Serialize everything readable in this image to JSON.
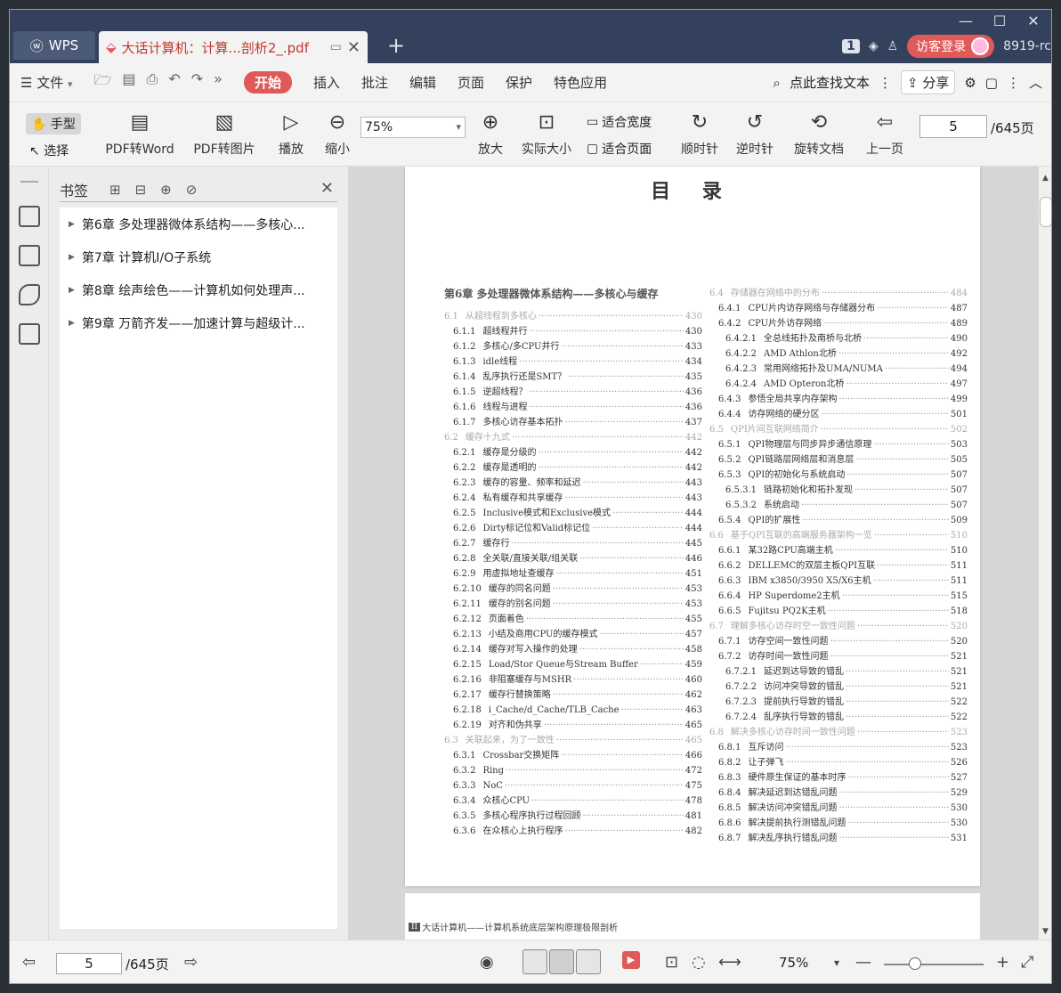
{
  "tabs": {
    "wps_label": "WPS",
    "doc_title": "大话计算机：计算...剖析2_.pdf",
    "add": "+"
  },
  "titlebar": {
    "badge": "1",
    "login": "访客登录",
    "user": "8919-rc"
  },
  "menu": {
    "file": "文件",
    "items": [
      "开始",
      "插入",
      "批注",
      "编辑",
      "页面",
      "保护",
      "特色应用"
    ],
    "search": "点此查找文本",
    "share": "分享"
  },
  "ribbon": {
    "hand": "手型",
    "select": "选择",
    "pdf_to_word": "PDF转Word",
    "pdf_to_image": "PDF转图片",
    "play": "播放",
    "zoom_out": "缩小",
    "zoom_value": "75%",
    "zoom_in": "放大",
    "actual_size": "实际大小",
    "fit_width": "适合宽度",
    "fit_page": "适合页面",
    "clockwise": "顺时针",
    "counter_clockwise": "逆时针",
    "rotate_doc": "旋转文档",
    "prev_page": "上一页",
    "page_value": "5",
    "page_total": "/645页"
  },
  "bookmarks": {
    "label": "书签",
    "items": [
      "第6章  多处理器微体系结构——多核心...",
      "第7章  计算机I/O子系统",
      "第8章  绘声绘色——计算机如何处理声...",
      "第9章  万箭齐发——加速计算与超级计..."
    ]
  },
  "toc": {
    "title": "目 录",
    "left_chapter": "第6章   多处理器微体系结构——多核心与缓存",
    "left": [
      {
        "n": "6.1",
        "t": "从超线程到多核心",
        "p": "430",
        "k": "sec"
      },
      {
        "n": "6.1.1",
        "t": "超线程并行",
        "p": "430",
        "k": "lvl1"
      },
      {
        "n": "6.1.2",
        "t": "多核心/多CPU并行",
        "p": "433",
        "k": "lvl1"
      },
      {
        "n": "6.1.3",
        "t": "idle线程",
        "p": "434",
        "k": "lvl1"
      },
      {
        "n": "6.1.4",
        "t": "乱序执行还是SMT？",
        "p": "435",
        "k": "lvl1"
      },
      {
        "n": "6.1.5",
        "t": "逆超线程？",
        "p": "436",
        "k": "lvl1"
      },
      {
        "n": "6.1.6",
        "t": "线程与进程",
        "p": "436",
        "k": "lvl1"
      },
      {
        "n": "6.1.7",
        "t": "多核心访存基本拓扑",
        "p": "437",
        "k": "lvl1"
      },
      {
        "n": "6.2",
        "t": "缓存十九式",
        "p": "442",
        "k": "sec"
      },
      {
        "n": "6.2.1",
        "t": "缓存是分级的",
        "p": "442",
        "k": "lvl1"
      },
      {
        "n": "6.2.2",
        "t": "缓存是透明的",
        "p": "442",
        "k": "lvl1"
      },
      {
        "n": "6.2.3",
        "t": "缓存的容量、频率和延迟",
        "p": "443",
        "k": "lvl1"
      },
      {
        "n": "6.2.4",
        "t": "私有缓存和共享缓存",
        "p": "443",
        "k": "lvl1"
      },
      {
        "n": "6.2.5",
        "t": "Inclusive模式和Exclusive模式",
        "p": "444",
        "k": "lvl1"
      },
      {
        "n": "6.2.6",
        "t": "Dirty标记位和Valid标记位",
        "p": "444",
        "k": "lvl1"
      },
      {
        "n": "6.2.7",
        "t": "缓存行",
        "p": "445",
        "k": "lvl1"
      },
      {
        "n": "6.2.8",
        "t": "全关联/直接关联/组关联",
        "p": "446",
        "k": "lvl1"
      },
      {
        "n": "6.2.9",
        "t": "用虚拟地址查缓存",
        "p": "451",
        "k": "lvl1"
      },
      {
        "n": "6.2.10",
        "t": "缓存的同名问题",
        "p": "453",
        "k": "lvl1"
      },
      {
        "n": "6.2.11",
        "t": "缓存的别名问题",
        "p": "453",
        "k": "lvl1"
      },
      {
        "n": "6.2.12",
        "t": "页面着色",
        "p": "455",
        "k": "lvl1"
      },
      {
        "n": "6.2.13",
        "t": "小结及商用CPU的缓存模式",
        "p": "457",
        "k": "lvl1"
      },
      {
        "n": "6.2.14",
        "t": "缓存对写入操作的处理",
        "p": "458",
        "k": "lvl1"
      },
      {
        "n": "6.2.15",
        "t": "Load/Stor Queue与Stream Buffer",
        "p": "459",
        "k": "lvl1"
      },
      {
        "n": "6.2.16",
        "t": "非阻塞缓存与MSHR",
        "p": "460",
        "k": "lvl1"
      },
      {
        "n": "6.2.17",
        "t": "缓存行替换策略",
        "p": "462",
        "k": "lvl1"
      },
      {
        "n": "6.2.18",
        "t": "i_Cache/d_Cache/TLB_Cache",
        "p": "463",
        "k": "lvl1"
      },
      {
        "n": "6.2.19",
        "t": "对齐和伪共享",
        "p": "465",
        "k": "lvl1"
      },
      {
        "n": "6.3",
        "t": "关联起来，为了一致性",
        "p": "465",
        "k": "sec"
      },
      {
        "n": "6.3.1",
        "t": "Crossbar交换矩阵",
        "p": "466",
        "k": "lvl1"
      },
      {
        "n": "6.3.2",
        "t": "Ring",
        "p": "472",
        "k": "lvl1"
      },
      {
        "n": "6.3.3",
        "t": "NoC",
        "p": "475",
        "k": "lvl1"
      },
      {
        "n": "6.3.4",
        "t": "众核心CPU",
        "p": "478",
        "k": "lvl1"
      },
      {
        "n": "6.3.5",
        "t": "多核心程序执行过程回顾",
        "p": "481",
        "k": "lvl1"
      },
      {
        "n": "6.3.6",
        "t": "在众核心上执行程序",
        "p": "482",
        "k": "lvl1"
      }
    ],
    "right": [
      {
        "n": "6.4",
        "t": "存储器在网络中的分布",
        "p": "484",
        "k": "sec"
      },
      {
        "n": "6.4.1",
        "t": "CPU片内访存网络与存储器分布",
        "p": "487",
        "k": "lvl1"
      },
      {
        "n": "6.4.2",
        "t": "CPU片外访存网络",
        "p": "489",
        "k": "lvl1"
      },
      {
        "n": "6.4.2.1",
        "t": "全总线拓扑及南桥与北桥",
        "p": "490",
        "k": "lvl2"
      },
      {
        "n": "6.4.2.2",
        "t": "AMD Athlon北桥",
        "p": "492",
        "k": "lvl2"
      },
      {
        "n": "6.4.2.3",
        "t": "常用网络拓扑及UMA/NUMA",
        "p": "494",
        "k": "lvl2"
      },
      {
        "n": "6.4.2.4",
        "t": "AMD Opteron北桥",
        "p": "497",
        "k": "lvl2"
      },
      {
        "n": "6.4.3",
        "t": "参悟全局共享内存架构",
        "p": "499",
        "k": "lvl1"
      },
      {
        "n": "6.4.4",
        "t": "访存网络的硬分区",
        "p": "501",
        "k": "lvl1"
      },
      {
        "n": "6.5",
        "t": "QPI片间互联网络简介",
        "p": "502",
        "k": "sec"
      },
      {
        "n": "6.5.1",
        "t": "QPI物理层与同步异步通信原理",
        "p": "503",
        "k": "lvl1"
      },
      {
        "n": "6.5.2",
        "t": "QPI链路层网络层和消息层",
        "p": "505",
        "k": "lvl1"
      },
      {
        "n": "6.5.3",
        "t": "QPI的初始化与系统启动",
        "p": "507",
        "k": "lvl1"
      },
      {
        "n": "6.5.3.1",
        "t": "链路初始化和拓扑发现",
        "p": "507",
        "k": "lvl2"
      },
      {
        "n": "6.5.3.2",
        "t": "系统启动",
        "p": "507",
        "k": "lvl2"
      },
      {
        "n": "6.5.4",
        "t": "QPI的扩展性",
        "p": "509",
        "k": "lvl1"
      },
      {
        "n": "6.6",
        "t": "基于QPI互联的高端服务器架构一览",
        "p": "510",
        "k": "sec"
      },
      {
        "n": "6.6.1",
        "t": "某32路CPU高端主机",
        "p": "510",
        "k": "lvl1"
      },
      {
        "n": "6.6.2",
        "t": "DELLEMC的双层主板QPI互联",
        "p": "511",
        "k": "lvl1"
      },
      {
        "n": "6.6.3",
        "t": "IBM x3850/3950 X5/X6主机",
        "p": "511",
        "k": "lvl1"
      },
      {
        "n": "6.6.4",
        "t": "HP Superdome2主机",
        "p": "515",
        "k": "lvl1"
      },
      {
        "n": "6.6.5",
        "t": "Fujitsu PQ2K主机",
        "p": "518",
        "k": "lvl1"
      },
      {
        "n": "6.7",
        "t": "理解多核心访存时空一致性问题",
        "p": "520",
        "k": "sec"
      },
      {
        "n": "6.7.1",
        "t": "访存空间一致性问题",
        "p": "520",
        "k": "lvl1"
      },
      {
        "n": "6.7.2",
        "t": "访存时间一致性问题",
        "p": "521",
        "k": "lvl1"
      },
      {
        "n": "6.7.2.1",
        "t": "延迟到达导致的错乱",
        "p": "521",
        "k": "lvl2"
      },
      {
        "n": "6.7.2.2",
        "t": "访问冲突导致的错乱",
        "p": "521",
        "k": "lvl2"
      },
      {
        "n": "6.7.2.3",
        "t": "提前执行导致的错乱",
        "p": "522",
        "k": "lvl2"
      },
      {
        "n": "6.7.2.4",
        "t": "乱序执行导致的错乱",
        "p": "522",
        "k": "lvl2"
      },
      {
        "n": "6.8",
        "t": "解决多核心访存时间一致性问题",
        "p": "523",
        "k": "sec"
      },
      {
        "n": "6.8.1",
        "t": "互斥访问",
        "p": "523",
        "k": "lvl1"
      },
      {
        "n": "6.8.2",
        "t": "让子弹飞",
        "p": "526",
        "k": "lvl1"
      },
      {
        "n": "6.8.3",
        "t": "硬件原生保证的基本时序",
        "p": "527",
        "k": "lvl1"
      },
      {
        "n": "6.8.4",
        "t": "解决延迟到达错乱问题",
        "p": "529",
        "k": "lvl1"
      },
      {
        "n": "6.8.5",
        "t": "解决访问冲突错乱问题",
        "p": "530",
        "k": "lvl1"
      },
      {
        "n": "6.8.6",
        "t": "解决提前执行测错乱问题",
        "p": "530",
        "k": "lvl1"
      },
      {
        "n": "6.8.7",
        "t": "解决乱序执行错乱问题",
        "p": "531",
        "k": "lvl1"
      }
    ]
  },
  "page2": {
    "page_label": "II",
    "header": "大话计算机——计算机系统底层架构原理极限剖析"
  },
  "statusbar": {
    "page_value": "5",
    "page_total": "/645页",
    "zoom": "75%",
    "zoom_fraction": 0.31
  },
  "colors": {
    "titlebar": "#33415c",
    "accent": "#e05a5a"
  }
}
